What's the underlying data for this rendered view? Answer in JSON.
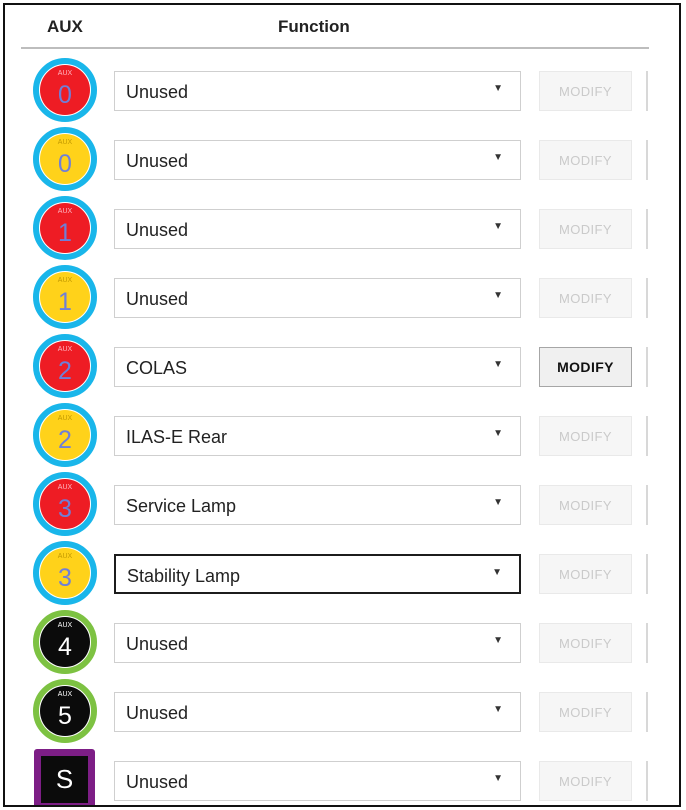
{
  "header": {
    "aux_label": "AUX",
    "function_label": "Function"
  },
  "rows": [
    {
      "badge_tag": "AUX",
      "badge_num": "0",
      "badge_color": "red",
      "function": "Unused",
      "modify": "MODIFY",
      "modify_enabled": false,
      "focused": false
    },
    {
      "badge_tag": "AUX",
      "badge_num": "0",
      "badge_color": "yellow",
      "function": "Unused",
      "modify": "MODIFY",
      "modify_enabled": false,
      "focused": false
    },
    {
      "badge_tag": "AUX",
      "badge_num": "1",
      "badge_color": "red",
      "function": "Unused",
      "modify": "MODIFY",
      "modify_enabled": false,
      "focused": false
    },
    {
      "badge_tag": "AUX",
      "badge_num": "1",
      "badge_color": "yellow",
      "function": "Unused",
      "modify": "MODIFY",
      "modify_enabled": false,
      "focused": false
    },
    {
      "badge_tag": "AUX",
      "badge_num": "2",
      "badge_color": "red",
      "function": "COLAS",
      "modify": "MODIFY",
      "modify_enabled": true,
      "focused": false
    },
    {
      "badge_tag": "AUX",
      "badge_num": "2",
      "badge_color": "yellow",
      "function": "ILAS-E Rear",
      "modify": "MODIFY",
      "modify_enabled": false,
      "focused": false
    },
    {
      "badge_tag": "AUX",
      "badge_num": "3",
      "badge_color": "red",
      "function": "Service Lamp",
      "modify": "MODIFY",
      "modify_enabled": false,
      "focused": false
    },
    {
      "badge_tag": "AUX",
      "badge_num": "3",
      "badge_color": "yellow",
      "function": "Stability Lamp",
      "modify": "MODIFY",
      "modify_enabled": false,
      "focused": true
    },
    {
      "badge_tag": "AUX",
      "badge_num": "4",
      "badge_color": "black",
      "function": "Unused",
      "modify": "MODIFY",
      "modify_enabled": false,
      "focused": false
    },
    {
      "badge_tag": "AUX",
      "badge_num": "5",
      "badge_color": "black",
      "function": "Unused",
      "modify": "MODIFY",
      "modify_enabled": false,
      "focused": false
    },
    {
      "badge_tag": "",
      "badge_num": "S",
      "badge_color": "square",
      "function": "Unused",
      "modify": "MODIFY",
      "modify_enabled": false,
      "focused": false
    }
  ],
  "colors": {
    "badge_ring": "#19b6ea",
    "badge_red": "#ee1c24",
    "badge_yellow": "#ffd21a",
    "badge_black_ring": "#7dc242",
    "badge_square": "#7d1e86"
  }
}
